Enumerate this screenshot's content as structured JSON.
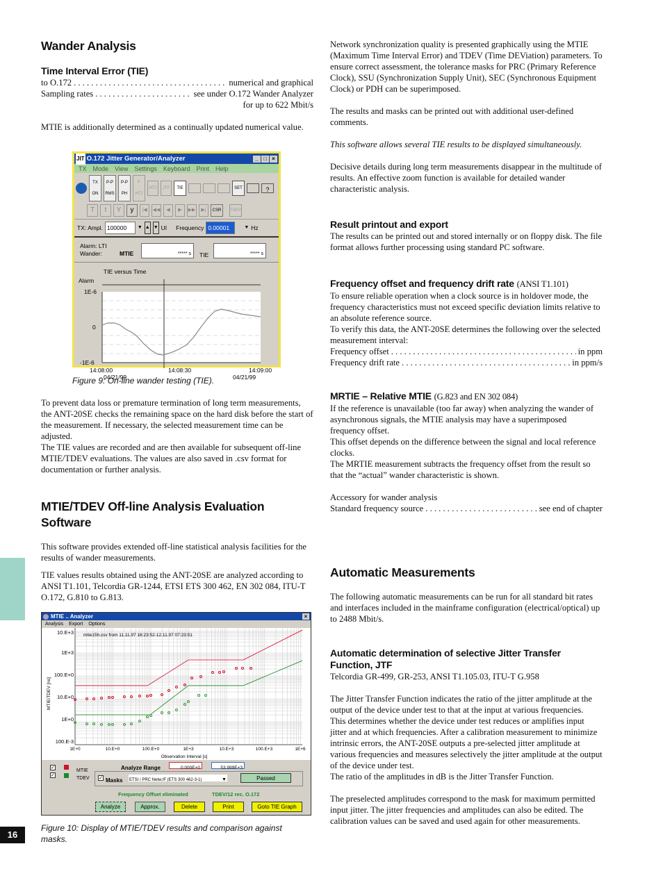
{
  "left": {
    "wander_title": "Wander Analysis",
    "tie_title": "Time Interval Error (TIE)",
    "tie_spec": [
      {
        "label": "to O.172",
        "value": "numerical and graphical"
      },
      {
        "label": "Sampling rates",
        "value": "see under O.172 Wander Analyzer"
      }
    ],
    "tie_spec_cont": "for up to 622 Mbit/s",
    "mtie_para": "MTIE is additionally determined as a continually updated numerical value.",
    "fig9_caption": "Figure 9: On-line wander testing (TIE).",
    "loss_para": "To prevent data loss or premature termination of long term measurements, the ANT-20SE checks the remaining space on the hard disk before the start of the measurement. If necessary, the selected measurement time can be adjusted.",
    "tie_values_para": "The TIE values are recorded and are then available for subsequent off-line MTIE/TDEV evaluations. The values are also saved in .csv format for documentation or further analysis.",
    "offline_title": "MTIE/TDEV Off-line Analysis Evaluation Software",
    "offline_para1": "This software provides extended off-line statistical analysis facilities for the results of wander measurements.",
    "offline_para2": "TIE values results obtained using the ANT-20SE are analyzed according to ANSI T1.101, Telcordia GR-1244, ETSI ETS 300 462, EN 302 084, ITU-T O.172, G.810 to G.813.",
    "fig10_caption": "Figure 10: Display of MTIE/TDEV results and comparison against masks."
  },
  "right": {
    "sync_para": "Network synchronization quality is presented graphically using the MTIE (Maximum Time Interval Error) and TDEV (Time DEViation) parameters. To ensure correct assessment, the tolerance masks for PRC (Primary Reference Clock), SSU (Synchronization Supply Unit), SEC (Synchronous Equipment Clock) or PDH can be superimposed.",
    "print_para": "The results and masks can be printed out with additional user-defined comments.",
    "italic_para": "This software allows several TIE results to be displayed simultaneously.",
    "zoom_para": "Decisive details during long term measurements disappear in the multitude of results. An effective zoom function is available for detailed wander characteristic analysis.",
    "result_title": "Result printout and export",
    "result_para": "The results can be printed out and stored internally or on floppy disk. The file format allows further processing using standard PC software.",
    "freq_title": "Frequency offset and frequency drift rate",
    "freq_title_note": "(ANSI T1.101)",
    "freq_para1": "To ensure reliable operation when a clock source is in holdover mode, the frequency characteristics must not exceed specific deviation limits relative to an absolute reference source.",
    "freq_para2": "To verify this data, the ANT-20SE determines the following over the selected measurement interval:",
    "freq_spec": [
      {
        "label": "Frequency offset",
        "value": "in ppm"
      },
      {
        "label": "Frequency drift rate",
        "value": "in ppm/s"
      }
    ],
    "mrtie_title": "MRTIE – Relative MTIE",
    "mrtie_title_note": "(G.823 and EN 302 084)",
    "mrtie_para1": "If the reference is unavailable (too far away) when analyzing the wander of asynchronous signals, the MTIE analysis may have a superimposed frequency offset.",
    "mrtie_para2": "This offset depends on the difference between the signal and local reference clocks.",
    "mrtie_para3": "The MRTIE measurement subtracts the frequency offset from the result so that the “actual” wander characteristic is shown.",
    "accessory_label": "Accessory for wander analysis",
    "accessory_spec": {
      "label": "Standard frequency source",
      "value": "see end of chapter"
    },
    "auto_title": "Automatic Measurements",
    "auto_para": "The following automatic measurements can be run for all standard bit rates and interfaces included in the mainframe configuration (electrical/optical) up to 2488 Mbit/s.",
    "jtf_title": "Automatic determination of selective Jitter Transfer Function, JTF",
    "jtf_standards": "Telcordia GR-499, GR-253, ANSI T1.105.03, ITU-T G.958",
    "jtf_para1": "The Jitter Transfer Function indicates the ratio of the jitter amplitude at the output of the device under test to that at the input at various frequencies.",
    "jtf_para2": "This determines whether the device under test reduces or amplifies input jitter and at which frequencies. After a calibration measurement to minimize intrinsic errors, the ANT-20SE outputs a pre-selected jitter amplitude at various frequencies and measures selectively the jitter amplitude at the output of the device under test.",
    "jtf_para3": "The ratio of the amplitudes in dB is the Jitter Transfer Function.",
    "jtf_para4": "The preselected amplitudes correspond to the mask for maximum permitted input jitter. The jitter frequencies and amplitudes can also be edited. The calibration values can be saved and used again for other measurements."
  },
  "page_number": "16",
  "fig9": {
    "title": "O.172 Jitter Generator/Analyzer",
    "logo": "JIT",
    "menu": [
      "TX",
      "Mode",
      "View",
      "Settings",
      "Keyboard",
      "Print",
      "Help"
    ],
    "toolbar1": [
      "TX ON",
      "P-P RMS",
      "P-P PH",
      "F HTJ",
      "HTJ",
      "JTF",
      "TIE",
      "SET"
    ],
    "toolbar2": [
      "T",
      "t",
      "Y",
      "y",
      "CSR",
      "TDEV"
    ],
    "tx_ampl_label": "TX: Ampl.",
    "tx_ampl_value": "100000",
    "unit_ui": "UI",
    "freq_label": "Frequency",
    "freq_value": "0.00001",
    "freq_unit": "Hz",
    "alarm": "Alarm: LTI",
    "wander": "Wander:",
    "mtie_label": "MTIE",
    "mtie_value": "***** s",
    "tie_label": "TIE",
    "tie_value": "***** s",
    "chart_title": "TIE versus Time",
    "alarm_line": "Alarm",
    "y_ticks": [
      "1E-6",
      "0",
      "-1E-6"
    ],
    "x_ticks": [
      "14:08:00",
      "14:08:30",
      "14:09:00"
    ],
    "x_dates": [
      "04/21/99",
      "04/21/99"
    ]
  },
  "fig10": {
    "title": "MTIE .. Analyzer",
    "menu": [
      "Analysis",
      "Export",
      "Options"
    ],
    "file_info": "mtie15h.csv from 11.11.97 16:23:52-12.11.97 07:23:51",
    "y_label": "MTIE/TDEV [ns]",
    "y_ticks": [
      "10.E+3",
      "1E+3",
      "100.E+0",
      "10.E+0",
      "1E+0",
      "100.E-3"
    ],
    "x_ticks": [
      "1E+0",
      "10.E+0",
      "100.E+0",
      "1E+3",
      "10.E+3",
      "100.E+3",
      "1E+6"
    ],
    "x_label": "Observation Interval [s]",
    "legend": [
      {
        "label": "MTIE",
        "color": "#d0102a",
        "checked": true
      },
      {
        "label": "TDEV",
        "color": "#1a8a2a",
        "checked": true
      }
    ],
    "range_label": "Analyze Range",
    "range_from": "0.000E+0",
    "range_to": "53.999E+3",
    "masks_label": "Masks",
    "masks_value": "ETSI / PRC Netw.IF (ETS 300 462-3-1)",
    "status": "Passed",
    "note1": "Frequency Offset eliminated",
    "note2": "TDEV/12 rec. O.172",
    "buttons": [
      "Analyze",
      "Approx.",
      "Delete",
      "Print",
      "Goto TIE Graph"
    ]
  }
}
